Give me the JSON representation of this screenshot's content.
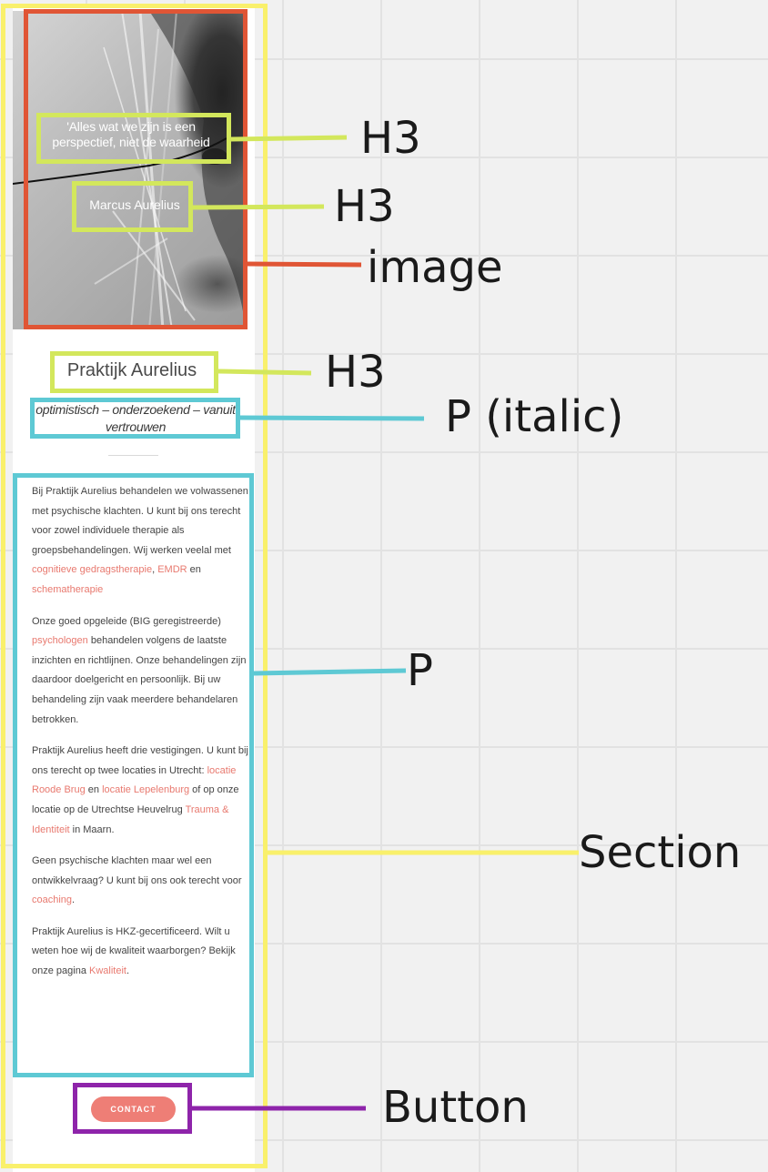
{
  "mockup": {
    "quote": "'Alles wat we zijn is een perspectief, niet de waarheid",
    "author": "Marcus Aurelius",
    "title": "Praktijk Aurelius",
    "tagline": "optimistisch – onderzoekend – vanuit vertrouwen",
    "paragraphs": [
      {
        "t1": "Bij Praktijk Aurelius behandelen we volwassenen met psychische klachten. U kunt bij ons terecht voor zowel individuele therapie als groepsbehandelingen. Wij werken veelal met ",
        "l1": "cognitieve gedragstherapie",
        "t2": ", ",
        "l2": "EMDR",
        "t3": " en ",
        "l3": "schematherapie"
      },
      {
        "t1": "Onze goed opgeleide (BIG geregistreerde) ",
        "l1": "psychologen",
        "t2": " behandelen volgens de laatste inzichten en richtlijnen. Onze behandelingen zijn daardoor doelgericht en persoonlijk. Bij uw behandeling zijn vaak meerdere behandelaren betrokken."
      },
      {
        "t1": "Praktijk Aurelius heeft drie vestigingen. U kunt bij ons terecht op twee locaties in Utrecht: ",
        "l1": "locatie Roode Brug",
        "t2": " en ",
        "l2": "locatie Lepelenburg",
        "t3": " of op onze locatie op de Utrechtse Heuvelrug ",
        "l3": "Trauma & Identiteit",
        "t4": " in Maarn."
      },
      {
        "t1": "Geen psychische klachten maar wel een ontwikkelvraag? U kunt bij ons ook terecht voor ",
        "l1": "coaching",
        "t2": "."
      },
      {
        "t1": "Praktijk Aurelius is HKZ-gecertificeerd. Wilt u weten hoe wij de kwaliteit waarborgen? Bekijk onze pagina ",
        "l1": "Kwaliteit",
        "t2": "."
      }
    ],
    "button": "CONTACT"
  },
  "annotations": {
    "quote_tag": "H3",
    "author_tag": "H3",
    "image_tag": "image",
    "title_tag": "H3",
    "tagline_tag": "P (italic)",
    "paragraphs_tag": "P",
    "section_tag": "Section",
    "button_tag": "Button"
  },
  "colors": {
    "section": "#f9f06b",
    "image": "#e05535",
    "heading": "#d3e75c",
    "paragraph": "#5ec9d4",
    "button": "#8e24aa",
    "link": "#e8796f",
    "button_fill": "#ee7e76"
  }
}
